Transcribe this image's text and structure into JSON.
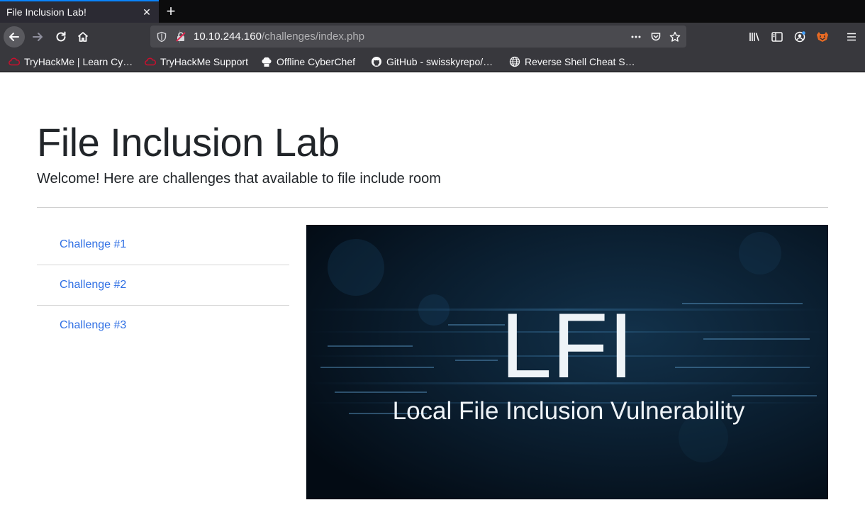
{
  "browser": {
    "tab_title": "File Inclusion Lab!",
    "url_host": "10.10.244.160",
    "url_path": "/challenges/index.php",
    "bookmarks": [
      {
        "label": "TryHackMe | Learn Cy…",
        "icon": "tryhackme-cloud-icon"
      },
      {
        "label": "TryHackMe Support",
        "icon": "tryhackme-cloud-icon"
      },
      {
        "label": "Offline CyberChef",
        "icon": "chef-hat-icon"
      },
      {
        "label": "GitHub - swisskyrepo/…",
        "icon": "github-icon"
      },
      {
        "label": "Reverse Shell Cheat S…",
        "icon": "globe-icon"
      }
    ]
  },
  "page": {
    "title": "File Inclusion Lab",
    "lead": "Welcome! Here are challenges that available to file include room",
    "challenges": [
      "Challenge #1",
      "Challenge #2",
      "Challenge #3"
    ],
    "hero": {
      "headline": "LFI",
      "subtitle": "Local File Inclusion Vulnerability"
    }
  },
  "colors": {
    "link": "#2f6fe4",
    "tab_accent": "#0a84ff",
    "hero_bg": "#04121f"
  }
}
